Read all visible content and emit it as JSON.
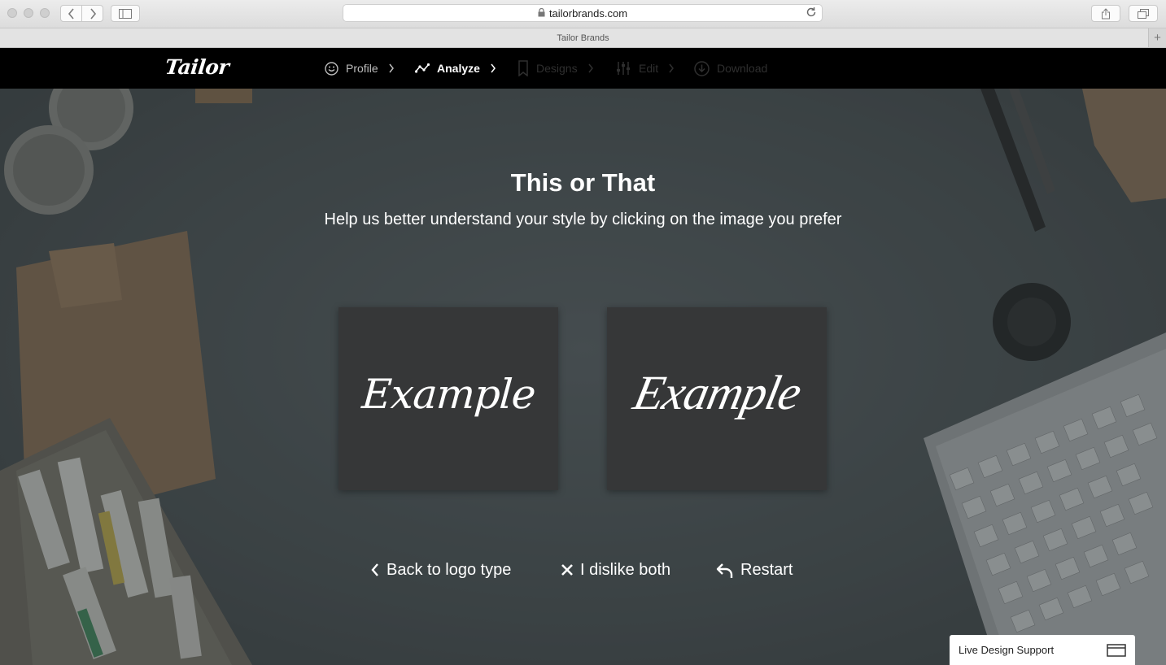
{
  "browser": {
    "url": "tailorbrands.com",
    "tab_title": "Tailor Brands",
    "new_tab_glyph": "+"
  },
  "nav": {
    "logo": "Tailor",
    "steps": [
      {
        "label": "Profile",
        "state": "done",
        "icon": "smiley-icon"
      },
      {
        "label": "Analyze",
        "state": "active",
        "icon": "analyze-graph-icon"
      },
      {
        "label": "Designs",
        "state": "future",
        "icon": "bookmark-icon"
      },
      {
        "label": "Edit",
        "state": "future",
        "icon": "sliders-icon"
      },
      {
        "label": "Download",
        "state": "future",
        "icon": "download-icon"
      }
    ]
  },
  "main": {
    "title": "This or That",
    "subtitle": "Help us better understand your style by clicking on the image you prefer",
    "options": [
      {
        "sample": "Example"
      },
      {
        "sample": "Example"
      }
    ],
    "actions": {
      "back": "Back to logo type",
      "dislike": "I dislike both",
      "restart": "Restart"
    }
  },
  "support": {
    "label": "Live Design Support"
  },
  "colors": {
    "nav_bg": "#000000",
    "card_bg": "#363738",
    "text": "#ffffff"
  }
}
